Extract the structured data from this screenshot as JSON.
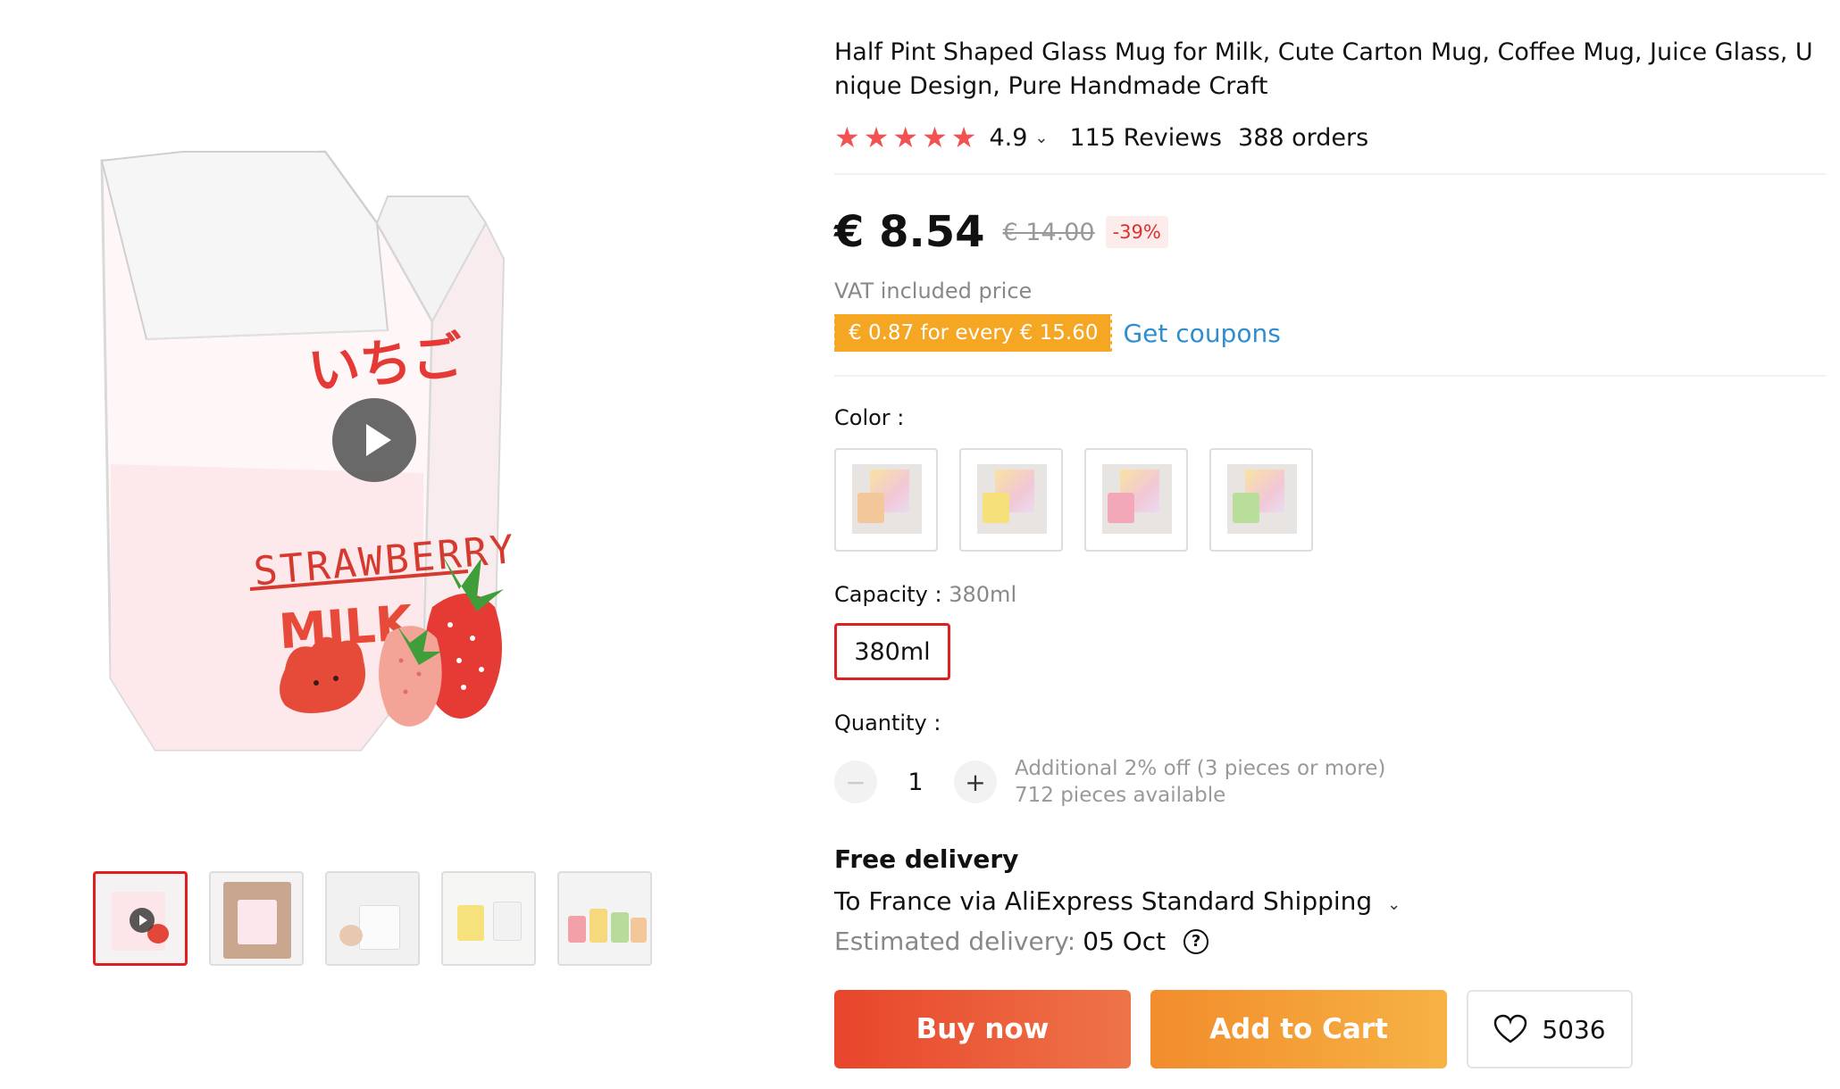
{
  "product": {
    "title": "Half Pint Shaped Glass Mug for Milk, Cute Carton Mug, Coffee Mug, Juice Glass, Unique Design, Pure Handmade Craft",
    "image_text": {
      "japanese": "いちご",
      "brand_line": "STRAWBERRY",
      "milk": "MILK"
    }
  },
  "rating": {
    "stars": 5,
    "value": "4.9",
    "reviews": "115 Reviews",
    "orders": "388 orders"
  },
  "price": {
    "current": "€ 8.54",
    "original": "€ 14.00",
    "discount": "-39%",
    "vat_note": "VAT included price",
    "coupon_badge": "€ 0.87 for every € 15.60",
    "coupon_link": "Get coupons"
  },
  "options": {
    "color_label": "Color :",
    "color_swatches": [
      {
        "cup_color": "#f3c79a"
      },
      {
        "cup_color": "#f5e07a"
      },
      {
        "cup_color": "#f2a8b8"
      },
      {
        "cup_color": "#b9dd9a"
      }
    ],
    "capacity_label": "Capacity :",
    "capacity_selected": "380ml",
    "capacity_option": "380ml"
  },
  "quantity": {
    "label": "Quantity :",
    "minus": "−",
    "value": "1",
    "plus": "+",
    "note_discount": "Additional 2% off (3 pieces or more)",
    "note_available": "712 pieces available"
  },
  "delivery": {
    "title": "Free delivery",
    "route": "To France via AliExpress Standard Shipping",
    "estimated_label": "Estimated delivery:",
    "estimated_date": "05 Oct",
    "help": "?"
  },
  "actions": {
    "buy_now": "Buy now",
    "add_to_cart": "Add to Cart",
    "wishlist_count": "5036"
  },
  "colors": {
    "star": "#f25252",
    "accent_red": "#e02020",
    "coupon_orange": "#f5a623",
    "link_blue": "#2f8ecf"
  }
}
